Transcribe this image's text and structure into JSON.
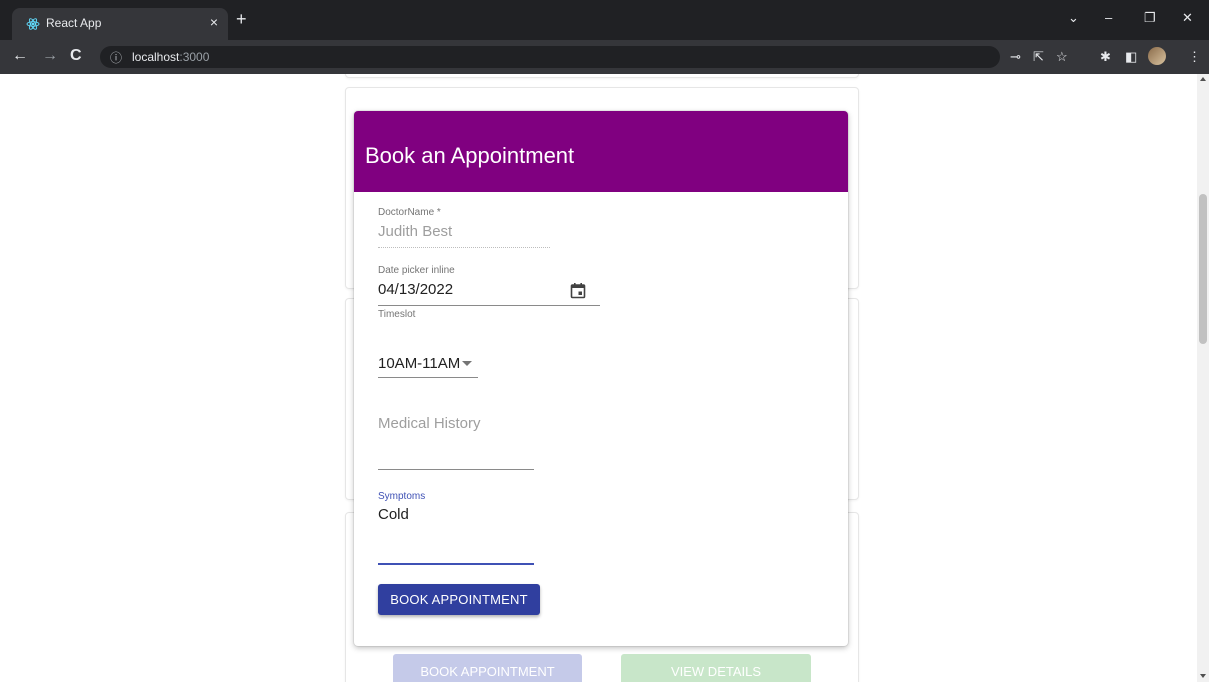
{
  "browser": {
    "tab_title": "React App",
    "tab_close": "×",
    "new_tab": "+",
    "url_host": "localhost",
    "url_port": ":3000",
    "win_controls": [
      "⌄",
      "–",
      "❐",
      "✕"
    ]
  },
  "dialog": {
    "title": "Book an Appointment",
    "doctor": {
      "label": "DoctorName *",
      "value": "Judith Best"
    },
    "date": {
      "label": "Date picker inline",
      "value": "04/13/2022"
    },
    "timeslot": {
      "label": "Timeslot",
      "value": "10AM-11AM"
    },
    "medical_history": {
      "placeholder": "Medical History"
    },
    "symptoms": {
      "label": "Symptoms",
      "value": "Cold"
    },
    "submit_label": "BOOK APPOINTMENT"
  },
  "background_buttons": {
    "book_label": "BOOK APPOINTMENT",
    "view_label": "VIEW DETAILS"
  },
  "colors": {
    "header": "#800080",
    "primary": "#303f9f",
    "book_faded": "#c5cae9",
    "view_faded": "#c8e6c9"
  }
}
